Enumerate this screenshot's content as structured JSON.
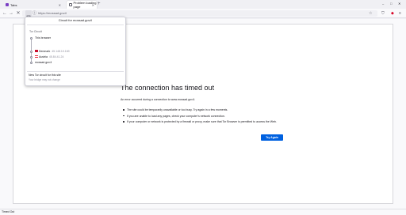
{
  "tabs": [
    {
      "label": "Tabs",
      "favicon_color": "#7b3fc4"
    },
    {
      "label": "Problem loading page",
      "favicon_color": "#ffffff"
    }
  ],
  "window_controls": {
    "minimize": "–",
    "maximize": "□",
    "close": "✕"
  },
  "toolbar": {
    "url": "https://mossad.gov.il",
    "icons": [
      "back-icon",
      "forward-icon",
      "reload-icon",
      "circuit-icon",
      "info-icon",
      "bookmark-star-icon",
      "shield-icon",
      "extension-icon",
      "menu-icon"
    ]
  },
  "circuit_panel": {
    "title": "Circuit for mossad.gov.il",
    "section_label": "Tor Circuit",
    "nodes": [
      {
        "label": "This browser",
        "ip": ""
      },
      {
        "label": "Denmark",
        "ip": "45.148.10.169",
        "flag": "#c8102e"
      },
      {
        "label": "Austria",
        "ip": "45.84.41.24",
        "flag": "#ed2939"
      },
      {
        "label": "mossad.gov.il",
        "ip": ""
      }
    ],
    "new_circuit_label": "New Tor circuit for this site",
    "bridge_note": "Your bridge may not change"
  },
  "error_page": {
    "title": "The connection has timed out",
    "description": "An error occurred during a connection to www.mossad.gov.il.",
    "bullets": [
      "The site could be temporarily unavailable or too busy. Try again in a few moments.",
      "If you are unable to load any pages, check your computer’s network connection.",
      "If your computer or network is protected by a firewall or proxy, make sure that Tor Browser is permitted to access the Web."
    ],
    "try_again_label": "Try Again"
  },
  "status_bar": {
    "text": "Timed Out"
  }
}
